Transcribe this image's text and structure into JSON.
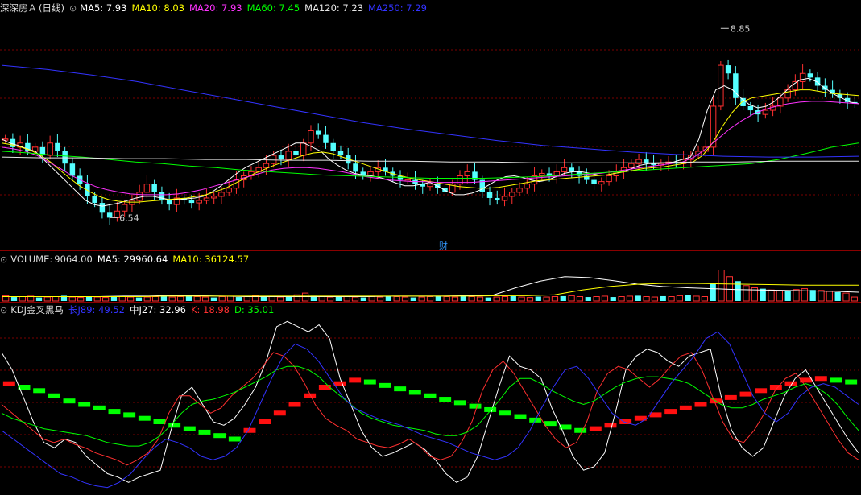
{
  "stock": {
    "name": "深深房Ａ",
    "period": "(日线)"
  },
  "price_panel": {
    "ma": [
      {
        "label": "MA5",
        "value": "7.93",
        "color": "#ffffff"
      },
      {
        "label": "MA10",
        "value": "8.03",
        "color": "#ffff00"
      },
      {
        "label": "MA20",
        "value": "7.93",
        "color": "#ff33ff"
      },
      {
        "label": "MA60",
        "value": "7.45",
        "color": "#00ff00"
      },
      {
        "label": "MA120",
        "value": "7.23",
        "color": "#e8e8e8"
      },
      {
        "label": "MA250",
        "value": "7.29",
        "color": "#3333ff"
      }
    ],
    "high_mark": "8.85",
    "low_mark": "6.54",
    "finance_tag": "财"
  },
  "volume_panel": {
    "label": "VOLUME",
    "value": "9064.00",
    "ma": [
      {
        "label": "MA5",
        "value": "29960.64",
        "color": "#ffffff"
      },
      {
        "label": "MA10",
        "value": "36124.57",
        "color": "#ffff00"
      }
    ]
  },
  "kdj_panel": {
    "name": "KDJ金叉黑马",
    "items": [
      {
        "label": "长J89",
        "value": "49.52",
        "color": "#3333ff"
      },
      {
        "label": "中J27",
        "value": "32.96",
        "color": "#ffffff"
      },
      {
        "label": "K",
        "value": "18.98",
        "color": "#ff3030"
      },
      {
        "label": "D",
        "value": "35.01",
        "color": "#00ff00"
      }
    ]
  },
  "chart_data": [
    {
      "type": "candlestick",
      "title": "深深房Ａ (日线)",
      "ylim": [
        6.2,
        9.0
      ],
      "annotations": [
        {
          "text": "8.85",
          "kind": "high",
          "value": 8.85
        },
        {
          "text": "6.54",
          "kind": "low",
          "value": 6.54
        }
      ],
      "trend_points": [
        7.5,
        7.4,
        7.45,
        7.35,
        7.4,
        7.3,
        7.45,
        7.35,
        7.2,
        7.05,
        6.95,
        6.8,
        6.72,
        6.6,
        6.54,
        6.62,
        6.7,
        6.75,
        6.85,
        6.95,
        6.85,
        6.75,
        6.7,
        6.78,
        6.75,
        6.72,
        6.75,
        6.78,
        6.8,
        6.85,
        6.9,
        7.0,
        7.05,
        7.1,
        7.15,
        7.2,
        7.3,
        7.25,
        7.35,
        7.3,
        7.45,
        7.6,
        7.55,
        7.45,
        7.35,
        7.3,
        7.2,
        7.1,
        7.05,
        7.1,
        7.15,
        7.1,
        7.05,
        7.0,
        7.0,
        6.95,
        6.92,
        6.95,
        6.9,
        6.85,
        6.95,
        7.05,
        7.1,
        7.0,
        6.85,
        6.78,
        6.75,
        6.8,
        6.85,
        6.9,
        6.95,
        7.05,
        7.08,
        7.05,
        7.1,
        7.15,
        7.1,
        7.05,
        7.0,
        6.95,
        6.98,
        7.05,
        7.1,
        7.15,
        7.2,
        7.25,
        7.2,
        7.18,
        7.2,
        7.22,
        7.2,
        7.25,
        7.3,
        7.35,
        7.4,
        7.9,
        8.4,
        8.3,
        8.0,
        7.9,
        7.85,
        7.8,
        7.85,
        7.9,
        8.0,
        8.1,
        8.2,
        8.3,
        8.25,
        8.15,
        8.1,
        8.05,
        8.0,
        7.95,
        7.93
      ],
      "series": [
        {
          "name": "MA5",
          "values": [
            7.5,
            7.45,
            7.42,
            7.38,
            7.35,
            7.25,
            7.15,
            7.05,
            6.95,
            6.85,
            6.75,
            6.7,
            6.68,
            6.7,
            6.72,
            6.75,
            6.78,
            6.8,
            6.8,
            6.78,
            6.76,
            6.76,
            6.77,
            6.78,
            6.8,
            6.85,
            6.92,
            7.0,
            7.08,
            7.15,
            7.2,
            7.25,
            7.3,
            7.35,
            7.4,
            7.45,
            7.45,
            7.4,
            7.35,
            7.25,
            7.18,
            7.12,
            7.08,
            7.06,
            7.05,
            7.03,
            7.0,
            6.96,
            6.93,
            6.93,
            6.95,
            6.97,
            6.92,
            6.86,
            6.82,
            6.82,
            6.84,
            6.88,
            6.94,
            7.0,
            7.04,
            7.05,
            7.03,
            7.0,
            6.98,
            7.0,
            7.04,
            7.08,
            7.1,
            7.1,
            7.08,
            7.06,
            7.06,
            7.08,
            7.1,
            7.14,
            7.18,
            7.2,
            7.2,
            7.21,
            7.22,
            7.25,
            7.28,
            7.5,
            7.85,
            8.1,
            8.15,
            8.1,
            8.0,
            7.92,
            7.88,
            7.9,
            7.96,
            8.05,
            8.15,
            8.22,
            8.24,
            8.2,
            8.12,
            8.05,
            8.0,
            7.95,
            7.93
          ]
        },
        {
          "name": "MA10",
          "values": [
            7.45,
            7.43,
            7.4,
            7.36,
            7.3,
            7.22,
            7.12,
            7.02,
            6.93,
            6.86,
            6.8,
            6.76,
            6.74,
            6.73,
            6.73,
            6.74,
            6.75,
            6.76,
            6.77,
            6.78,
            6.8,
            6.82,
            6.86,
            6.9,
            6.96,
            7.02,
            7.08,
            7.13,
            7.18,
            7.22,
            7.26,
            7.3,
            7.33,
            7.34,
            7.32,
            7.28,
            7.24,
            7.2,
            7.16,
            7.12,
            7.08,
            7.05,
            7.02,
            7.0,
            6.98,
            6.96,
            6.94,
            6.92,
            6.91,
            6.9,
            6.9,
            6.91,
            6.93,
            6.95,
            6.97,
            6.99,
            7.0,
            7.01,
            7.02,
            7.03,
            7.04,
            7.05,
            7.06,
            7.08,
            7.1,
            7.12,
            7.14,
            7.15,
            7.16,
            7.18,
            7.2,
            7.22,
            7.3,
            7.45,
            7.65,
            7.82,
            7.95,
            8.0,
            8.02,
            8.04,
            8.06,
            8.08,
            8.1,
            8.1,
            8.08,
            8.06,
            8.05,
            8.04,
            8.03
          ]
        },
        {
          "name": "MA20",
          "values": [
            7.4,
            7.38,
            7.35,
            7.3,
            7.22,
            7.14,
            7.05,
            6.98,
            6.92,
            6.88,
            6.85,
            6.83,
            6.82,
            6.82,
            6.82,
            6.83,
            6.85,
            6.88,
            6.92,
            6.96,
            7.0,
            7.04,
            7.08,
            7.12,
            7.14,
            7.15,
            7.15,
            7.14,
            7.12,
            7.1,
            7.07,
            7.04,
            7.02,
            7.0,
            6.99,
            6.98,
            6.98,
            6.97,
            6.97,
            6.97,
            6.97,
            6.98,
            6.99,
            7.0,
            7.01,
            7.02,
            7.03,
            7.04,
            7.05,
            7.06,
            7.07,
            7.08,
            7.1,
            7.12,
            7.14,
            7.16,
            7.18,
            7.2,
            7.22,
            7.28,
            7.38,
            7.5,
            7.62,
            7.72,
            7.8,
            7.86,
            7.9,
            7.93,
            7.95,
            7.96,
            7.96,
            7.95,
            7.94,
            7.93
          ]
        },
        {
          "name": "MA60",
          "values": [
            7.35,
            7.33,
            7.3,
            7.28,
            7.25,
            7.22,
            7.2,
            7.17,
            7.15,
            7.12,
            7.1,
            7.08,
            7.06,
            7.05,
            7.04,
            7.03,
            7.02,
            7.02,
            7.02,
            7.03,
            7.04,
            7.06,
            7.08,
            7.1,
            7.12,
            7.14,
            7.16,
            7.18,
            7.2,
            7.25,
            7.32,
            7.4,
            7.45
          ]
        },
        {
          "name": "MA120",
          "values": [
            7.28,
            7.27,
            7.27,
            7.26,
            7.26,
            7.25,
            7.25,
            7.24,
            7.24,
            7.23,
            7.23,
            7.22,
            7.22,
            7.21,
            7.21,
            7.21,
            7.21,
            7.22,
            7.22,
            7.23,
            7.23,
            7.23
          ]
        },
        {
          "name": "MA250",
          "values": [
            8.4,
            8.35,
            8.28,
            8.2,
            8.1,
            8.0,
            7.9,
            7.8,
            7.7,
            7.62,
            7.55,
            7.48,
            7.42,
            7.38,
            7.34,
            7.31,
            7.29,
            7.28,
            7.28,
            7.29
          ]
        }
      ]
    },
    {
      "type": "bar",
      "title": "VOLUME",
      "ylim": [
        0,
        80000
      ],
      "values": [
        12,
        9,
        10,
        11,
        8,
        9,
        10,
        12,
        9,
        8,
        10,
        9,
        8,
        11,
        10,
        9,
        8,
        9,
        10,
        11,
        9,
        10,
        12,
        10,
        9,
        8,
        10,
        11,
        9,
        10,
        12,
        11,
        10,
        9,
        11,
        14,
        18,
        12,
        10,
        9,
        11,
        10,
        9,
        8,
        10,
        9,
        11,
        10,
        9,
        8,
        9,
        10,
        11,
        10,
        9,
        12,
        10,
        9,
        8,
        9,
        10,
        11,
        9,
        8,
        10,
        9,
        10,
        11,
        12,
        10,
        9,
        10,
        11,
        9,
        10,
        11,
        12,
        10,
        9,
        11,
        10,
        12,
        14,
        11,
        10,
        40,
        70,
        55,
        45,
        35,
        30,
        28,
        25,
        24,
        22,
        26,
        28,
        25,
        24,
        22,
        20,
        18,
        9
      ],
      "series": [
        {
          "name": "MA5",
          "values": [
            10,
            10,
            10,
            10,
            10,
            11,
            11,
            13,
            12,
            11,
            10,
            10,
            10,
            10,
            10,
            10,
            11,
            11,
            11,
            12,
            12,
            30,
            45,
            55,
            53,
            46,
            38,
            33,
            30,
            28,
            26,
            25,
            24,
            23,
            22,
            20
          ]
        },
        {
          "name": "MA10",
          "values": [
            10,
            10,
            10,
            10,
            10,
            10,
            11,
            11,
            11,
            11,
            11,
            11,
            11,
            11,
            11,
            11,
            11,
            11,
            12,
            12,
            14,
            25,
            33,
            38,
            40,
            40,
            39,
            38,
            37,
            36,
            36,
            36
          ]
        }
      ]
    },
    {
      "type": "line",
      "title": "KDJ金叉黑马",
      "ylim": [
        0,
        100
      ],
      "series": [
        {
          "name": "中J27",
          "values": [
            80,
            70,
            55,
            40,
            28,
            25,
            30,
            28,
            20,
            15,
            10,
            8,
            5,
            8,
            10,
            12,
            35,
            55,
            60,
            50,
            40,
            38,
            42,
            50,
            60,
            75,
            95,
            98,
            95,
            92,
            96,
            88,
            65,
            50,
            35,
            25,
            20,
            22,
            25,
            28,
            24,
            18,
            10,
            5,
            8,
            20,
            40,
            60,
            78,
            72,
            70,
            65,
            48,
            35,
            20,
            12,
            14,
            22,
            45,
            70,
            78,
            82,
            80,
            75,
            72,
            78,
            80,
            82,
            55,
            35,
            25,
            20,
            25,
            40,
            55,
            65,
            70,
            60,
            50,
            40,
            30,
            22
          ]
        },
        {
          "name": "K",
          "values": [
            50,
            45,
            40,
            35,
            30,
            28,
            30,
            27,
            25,
            22,
            20,
            18,
            15,
            18,
            22,
            30,
            45,
            55,
            55,
            50,
            45,
            48,
            55,
            60,
            65,
            72,
            80,
            78,
            72,
            62,
            50,
            42,
            38,
            35,
            30,
            28,
            26,
            25,
            27,
            30,
            26,
            20,
            18,
            20,
            28,
            40,
            58,
            70,
            75,
            68,
            58,
            48,
            38,
            30,
            25,
            28,
            40,
            58,
            68,
            72,
            70,
            65,
            60,
            65,
            72,
            78,
            80,
            70,
            55,
            40,
            30,
            28,
            35,
            45,
            58,
            65,
            68,
            60,
            50,
            40,
            30,
            22,
            18
          ]
        },
        {
          "name": "D",
          "values": [
            45,
            42,
            40,
            38,
            36,
            35,
            34,
            33,
            32,
            30,
            28,
            27,
            26,
            26,
            28,
            32,
            38,
            45,
            50,
            52,
            53,
            55,
            57,
            60,
            63,
            66,
            70,
            72,
            72,
            70,
            66,
            60,
            55,
            50,
            45,
            42,
            40,
            38,
            37,
            36,
            35,
            33,
            32,
            32,
            34,
            38,
            45,
            52,
            60,
            65,
            65,
            62,
            58,
            55,
            52,
            50,
            52,
            56,
            60,
            63,
            65,
            66,
            66,
            65,
            64,
            62,
            58,
            54,
            50,
            48,
            48,
            50,
            53,
            55,
            57,
            60,
            62,
            60,
            56,
            50,
            42,
            35
          ]
        },
        {
          "name": "长J89",
          "values": [
            35,
            30,
            25,
            20,
            15,
            10,
            8,
            5,
            3,
            2,
            5,
            10,
            18,
            25,
            30,
            28,
            25,
            20,
            18,
            20,
            25,
            35,
            50,
            65,
            78,
            85,
            82,
            75,
            65,
            55,
            48,
            45,
            42,
            40,
            38,
            35,
            32,
            30,
            28,
            25,
            22,
            20,
            18,
            20,
            25,
            35,
            48,
            60,
            70,
            72,
            65,
            55,
            45,
            40,
            38,
            42,
            52,
            62,
            70,
            78,
            88,
            92,
            85,
            70,
            55,
            45,
            40,
            45,
            55,
            60,
            62,
            60,
            55,
            50
          ]
        }
      ],
      "bars": [
        {
          "name": "trend",
          "red": [
            62,
            60,
            58,
            55,
            52,
            50,
            48,
            46,
            44,
            42,
            40,
            38,
            36,
            34,
            32,
            30,
            35,
            40,
            45,
            50,
            55,
            60,
            62,
            64,
            63,
            61,
            59,
            57,
            55,
            53,
            51,
            49,
            47,
            45,
            43,
            41,
            39,
            37,
            35,
            36,
            38,
            40,
            42,
            44,
            46,
            48,
            50,
            52,
            54,
            56,
            58,
            60,
            62,
            64,
            65,
            64,
            63
          ]
        }
      ]
    }
  ]
}
